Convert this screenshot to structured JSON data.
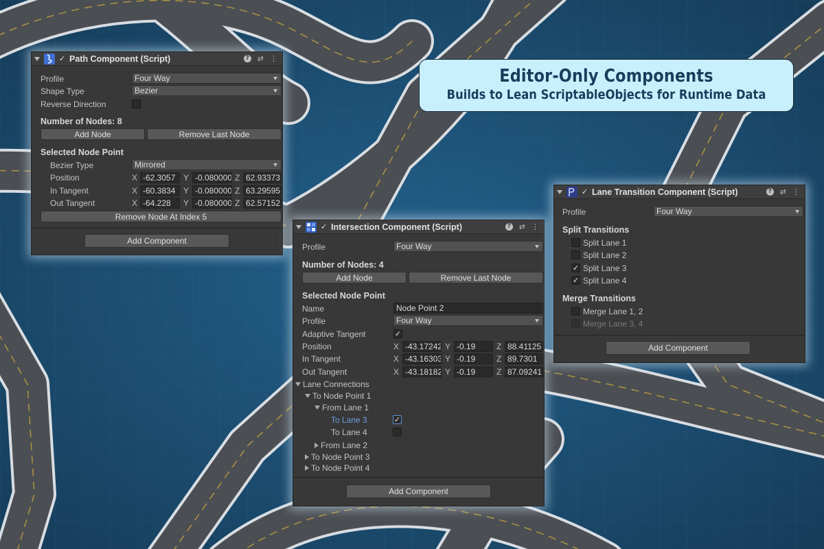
{
  "banner": {
    "line1": "Editor-Only Components",
    "line2": "Builds to Lean ScriptableObjects for Runtime Data"
  },
  "colors": {
    "background": "#1d4e72",
    "panel": "#383838",
    "banner_fill": "#c8f0fc",
    "banner_text": "#1a3d5c",
    "highlight_text": "#6f9ee0"
  },
  "path_panel": {
    "title": "Path Component (Script)",
    "icons": [
      "foldout-arrow-icon",
      "path-script-icon",
      "help-icon",
      "preset-icon",
      "kebab-menu-icon"
    ],
    "enabled_check": "✓",
    "profile_label": "Profile",
    "profile_value": "Four Way",
    "shape_type_label": "Shape Type",
    "shape_type_value": "Bezier",
    "reverse_label": "Reverse Direction",
    "nodes_label": "Number of Nodes: 8",
    "add_node": "Add Node",
    "remove_last_node": "Remove Last Node",
    "selected_label": "Selected Node Point",
    "bezier_type_label": "Bezier Type",
    "bezier_type_value": "Mirrored",
    "position_label": "Position",
    "position": {
      "x": "-62.3057",
      "y": "-0.080000",
      "z": "62.93373"
    },
    "in_tangent_label": "In Tangent",
    "in_tangent": {
      "x": "-60.3834",
      "y": "-0.080000",
      "z": "63.29595"
    },
    "out_tangent_label": "Out Tangent",
    "out_tangent": {
      "x": "-64.228",
      "y": "-0.080000",
      "z": "62.57152"
    },
    "remove_at_index": "Remove Node At Index 5",
    "add_component": "Add Component"
  },
  "intersection_panel": {
    "title": "Intersection Component (Script)",
    "enabled_check": "✓",
    "profile_label": "Profile",
    "profile_value": "Four Way",
    "nodes_label": "Number of Nodes: 4",
    "add_node": "Add Node",
    "remove_last_node": "Remove Last Node",
    "selected_label": "Selected Node Point",
    "name_label": "Name",
    "name_value": "Node Point 2",
    "node_profile_label": "Profile",
    "node_profile_value": "Four Way",
    "adaptive_label": "Adaptive Tangent",
    "adaptive_check": "✓",
    "position_label": "Position",
    "position": {
      "x": "-43.17242",
      "y": "-0.19",
      "z": "88.41125"
    },
    "in_tangent_label": "In Tangent",
    "in_tangent": {
      "x": "-43.16303",
      "y": "-0.19",
      "z": "89.7301"
    },
    "out_tangent_label": "Out Tangent",
    "out_tangent": {
      "x": "-43.18182",
      "y": "-0.19",
      "z": "87.09241"
    },
    "lane_connections": "Lane Connections",
    "to_node_1": "To Node Point 1",
    "from_lane_1": "From Lane 1",
    "to_lane_3": "To Lane 3",
    "to_lane_3_check": "✓",
    "to_lane_4": "To Lane 4",
    "from_lane_2": "From Lane 2",
    "to_node_3": "To Node Point 3",
    "to_node_4": "To Node Point 4",
    "add_component": "Add Component"
  },
  "lane_panel": {
    "title": "Lane Transition Component (Script)",
    "enabled_check": "✓",
    "profile_label": "Profile",
    "profile_value": "Four Way",
    "split_label": "Split Transitions",
    "split": [
      {
        "label": "Split Lane 1",
        "check": ""
      },
      {
        "label": "Split Lane 2",
        "check": ""
      },
      {
        "label": "Split Lane 3",
        "check": "✓"
      },
      {
        "label": "Split Lane 4",
        "check": "✓"
      }
    ],
    "merge_label": "Merge Transitions",
    "merge": [
      {
        "label": "Merge Lane 1, 2",
        "check": ""
      },
      {
        "label": "Merge Lane 3, 4",
        "check": ""
      }
    ],
    "add_component": "Add Component"
  },
  "axis": {
    "x": "X",
    "y": "Y",
    "z": "Z"
  }
}
